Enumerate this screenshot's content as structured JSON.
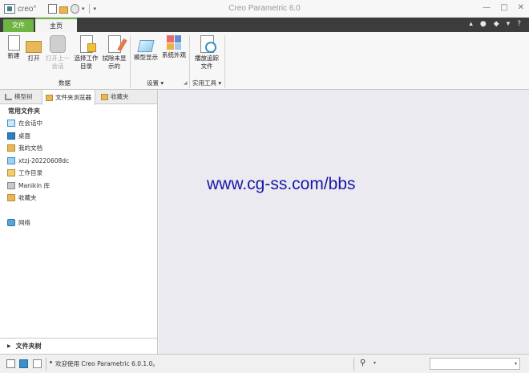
{
  "titlebar": {
    "logo": "creo°",
    "title": "Creo Parametric 6.0",
    "dropdown": "▾",
    "window_buttons": [
      "—",
      "□",
      "✕"
    ]
  },
  "ribbon_tabs": {
    "file": "文件",
    "home": "主页",
    "right_icons": [
      "▴",
      "●",
      "◆",
      "▾",
      "?"
    ]
  },
  "ribbon": {
    "buttons": [
      {
        "label": "新建"
      },
      {
        "label": "打开"
      },
      {
        "label": "打开上一\n会话",
        "disabled": true
      },
      {
        "label": "选择工作\n目录"
      },
      {
        "label": "拭除未显\n示的"
      },
      {
        "label": "模型显示"
      },
      {
        "label": "系统外观"
      },
      {
        "label": "播放追踪\n文件"
      }
    ],
    "groups": {
      "data": "数据",
      "settings": "设置 ▾",
      "utilities": "实用工具 ▾"
    },
    "sys_colors": [
      "#e86a6a",
      "#5d8fd0",
      "#f0b040",
      "#a8c8e8"
    ]
  },
  "panel": {
    "tabs": [
      "模型树",
      "文件夹浏览器",
      "收藏夹"
    ],
    "common_folders": "常用文件夹",
    "items": [
      {
        "label": "在会话中",
        "icon": "session-icon"
      },
      {
        "label": "桌面",
        "icon": "desktop-icon"
      },
      {
        "label": "我的文档",
        "icon": "documents-icon"
      },
      {
        "label": "xtzj-20220608dc",
        "icon": "computer-icon"
      },
      {
        "label": "工作目录",
        "icon": "working-dir-icon"
      },
      {
        "label": "Manikin 库",
        "icon": "library-icon"
      },
      {
        "label": "收藏夹",
        "icon": "favorites-icon"
      },
      {
        "label": "网络",
        "icon": "network-icon"
      }
    ],
    "folder_tree": "文件夹树"
  },
  "main": {
    "watermark": "www.cg-ss.com/bbs"
  },
  "status": {
    "message": "欢迎使用 Creo Parametric 6.0.1.0。",
    "find_icon": "binoculars-icon",
    "selection_value": ""
  }
}
